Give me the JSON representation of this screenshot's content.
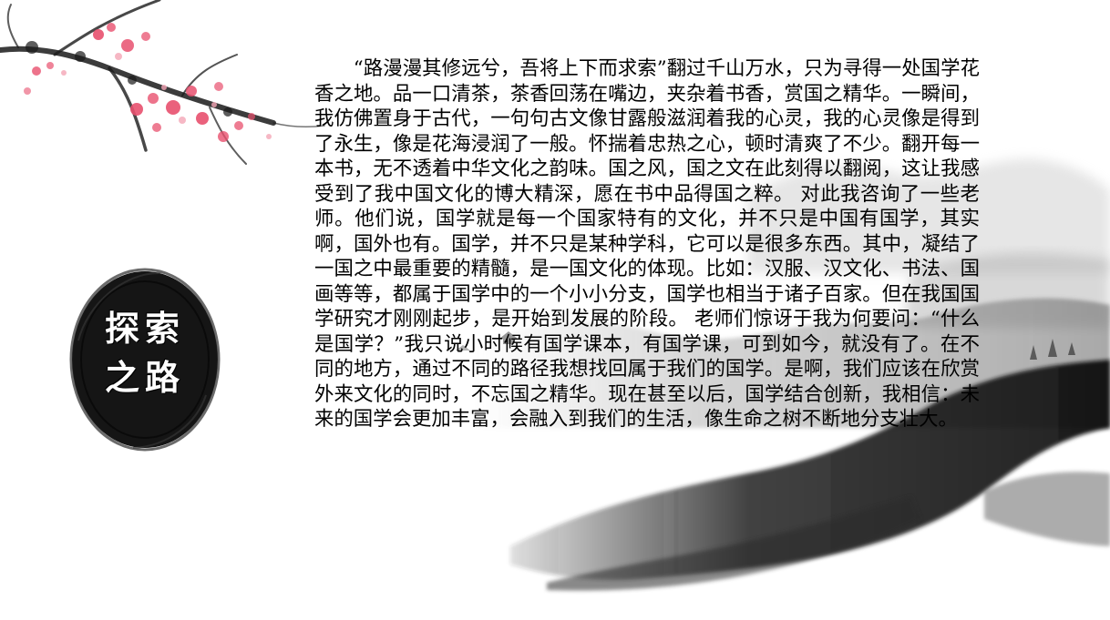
{
  "badge": {
    "title": "探索之路"
  },
  "article": {
    "text": "“路漫漫其修远兮，吾将上下而求索”翻过千山万水，只为寻得一处国学花香之地。品一口清茶，茶香回荡在嘴边，夹杂着书香，赏国之精华。一瞬间，我仿佛置身于古代，一句句古文像甘露般滋润着我的心灵，我的心灵像是得到了永生，像是花海浸润了一般。怀揣着忠热之心，顿时清爽了不少。翻开每一本书，无不透着中华文化之韵味。国之风，国之文在此刻得以翻阅，这让我感受到了我中国文化的博大精深，愿在书中品得国之粹。 对此我咨询了一些老师。他们说，国学就是每一个国家特有的文化，并不只是中国有国学，其实啊，国外也有。国学，并不只是某种学科，它可以是很多东西。其中，凝结了一国之中最重要的精髓，是一国文化的体现。比如：汉服、汉文化、书法、国画等等，都属于国学中的一个小小分支，国学也相当于诸子百家。但在我国国学研究才刚刚起步，是开始到发展的阶段。 老师们惊讶于我为何要问：“什么是国学？”我只说小时候有国学课本，有国学课，可到如今，就没有了。在不同的地方，通过不同的路径我想找回属于我们的国学。是啊，我们应该在欣赏外来文化的同时，不忘国之精华。现在甚至以后，国学结合创新，我相信：未来的国学会更加丰富，会融入到我们的生活，像生命之树不断地分支壮大。"
  },
  "colors": {
    "ink": "#1a1a1a",
    "plum_blossom": "#e8506e",
    "text": "#000000",
    "background": "#ffffff"
  },
  "decorations": {
    "landscape": "ink-wash-mountain-landscape",
    "branch": "plum-blossom-branch",
    "badge": "ink-brush-circle"
  }
}
